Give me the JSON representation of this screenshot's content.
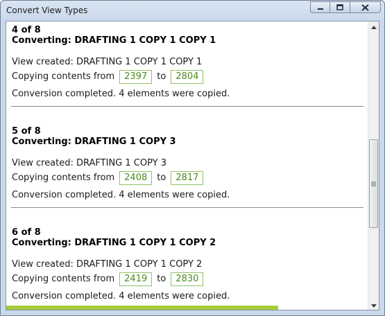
{
  "window": {
    "title": "Convert View Types",
    "minimize_icon": "minimize-icon",
    "maximize_icon": "maximize-icon",
    "close_icon": "close-icon"
  },
  "log": [
    {
      "counter": "4 of 8",
      "converting": "Converting: DRAFTING 1 COPY 1 COPY 1",
      "view_created": "View created: DRAFTING 1 COPY 1 COPY 1",
      "copying_prefix": "Copying contents from",
      "from": "2397",
      "to_word": "to",
      "to": "2804",
      "completed": "Conversion completed. 4 elements were copied."
    },
    {
      "counter": "5 of 8",
      "converting": "Converting: DRAFTING 1 COPY 3",
      "view_created": "View created: DRAFTING 1 COPY 3",
      "copying_prefix": "Copying contents from",
      "from": "2408",
      "to_word": "to",
      "to": "2817",
      "completed": "Conversion completed. 4 elements were copied."
    },
    {
      "counter": "6 of 8",
      "converting": "Converting: DRAFTING 1 COPY 1 COPY 2",
      "view_created": "View created: DRAFTING 1 COPY 1 COPY 2",
      "copying_prefix": "Copying contents from",
      "from": "2419",
      "to_word": "to",
      "to": "2830",
      "completed": "Conversion completed. 4 elements were copied."
    }
  ],
  "progress": {
    "fraction": 0.75,
    "color": "#a5cc3a"
  },
  "colors": {
    "number_box_border": "#8fc267",
    "number_text": "#4a8a1f"
  }
}
